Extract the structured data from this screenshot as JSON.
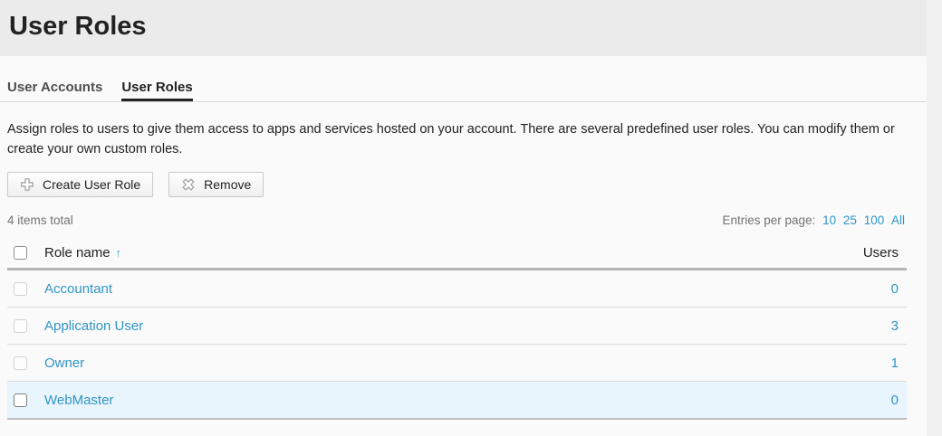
{
  "page": {
    "title": "User Roles"
  },
  "tabs": [
    {
      "label": "User Accounts",
      "active": false
    },
    {
      "label": "User Roles",
      "active": true
    }
  ],
  "description": "Assign roles to users to give them access to apps and services hosted on your account. There are several predefined user roles. You can modify them or create your own custom roles.",
  "toolbar": {
    "create_label": "Create User Role",
    "remove_label": "Remove",
    "create_icon": "plus-icon",
    "remove_icon": "x-icon"
  },
  "list": {
    "items_total": "4 items total",
    "entries_per_page_label": "Entries per page:",
    "page_size_options": [
      "10",
      "25",
      "100",
      "All"
    ],
    "columns": {
      "role": "Role name",
      "users": "Users"
    },
    "sort_arrow": "↑",
    "rows": [
      {
        "role": "Accountant",
        "users": "0",
        "highlighted": false
      },
      {
        "role": "Application User",
        "users": "3",
        "highlighted": false
      },
      {
        "role": "Owner",
        "users": "1",
        "highlighted": false
      },
      {
        "role": "WebMaster",
        "users": "0",
        "highlighted": true
      }
    ]
  },
  "colors": {
    "link": "#2e95c8",
    "active_tab_underline": "#222222",
    "row_highlight": "#e9f5fc",
    "title_band_bg": "#ebebeb",
    "content_bg": "#fafafa"
  }
}
